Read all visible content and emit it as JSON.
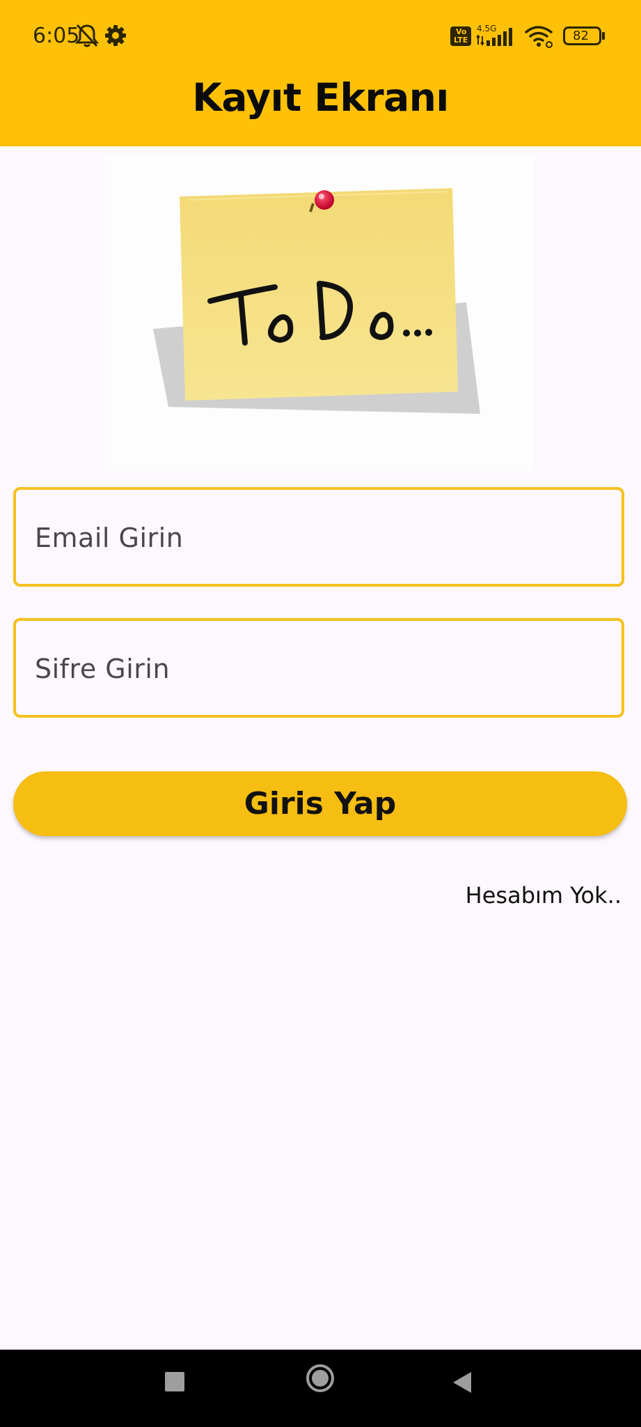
{
  "status_bar": {
    "time": "6:05",
    "battery_level": "82",
    "network_type": "4.5G",
    "volte_label_top": "Vo",
    "volte_label_bottom": "LTE",
    "icons": [
      "bell-off-icon",
      "settings-gear-icon",
      "volte-icon",
      "signal-bars-icon",
      "wifi-icon",
      "battery-icon"
    ]
  },
  "app_bar": {
    "title": "Kayıt Ekranı",
    "background_color": "#ffc107"
  },
  "hero_image": {
    "note_text": "To Do..."
  },
  "form": {
    "email_placeholder": "Email Girin",
    "email_value": "",
    "password_placeholder": "Sifre Girin",
    "password_value": "",
    "login_button_label": "Giris Yap",
    "no_account_link": "Hesabım Yok..",
    "accent_color": "#f6c020"
  },
  "nav_bar": {
    "buttons": [
      "recent-apps-icon",
      "home-icon",
      "back-icon"
    ]
  }
}
